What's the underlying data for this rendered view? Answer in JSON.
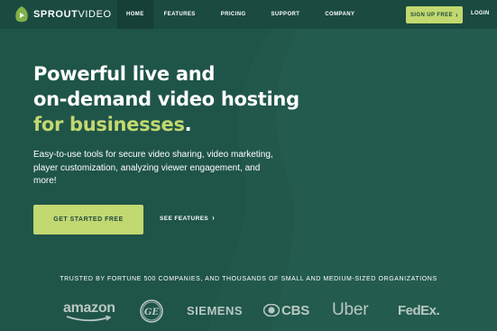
{
  "colors": {
    "background": "#1f5449",
    "header_background": "#1a4a40",
    "accent": "#c2d870",
    "accent_text": "#1f4a3d",
    "logo_muted": "#b9c8c3"
  },
  "brand": {
    "logo_icon": "play-icon",
    "name_bold": "SPROUT",
    "name_light": "VIDEO"
  },
  "nav": {
    "items": [
      {
        "label": "HOME",
        "active": true
      },
      {
        "label": "FEATURES",
        "active": false
      },
      {
        "label": "PRICING",
        "active": false
      },
      {
        "label": "SUPPORT",
        "active": false
      },
      {
        "label": "COMPANY",
        "active": false
      }
    ],
    "signup_label": "SIGN UP FREE",
    "signup_icon": "chevron-right-icon",
    "login_label": "LOGIN"
  },
  "hero": {
    "title_line1": "Powerful live and",
    "title_line2": "on-demand video hosting",
    "title_accent": "for businesses",
    "title_period": ".",
    "subtitle": "Easy-to-use tools for secure video sharing, video marketing, player customization, analyzing viewer engagement, and more!",
    "cta_label": "GET STARTED FREE",
    "secondary_label": "SEE FEATURES",
    "secondary_icon": "chevron-right-icon"
  },
  "trusted": {
    "heading": "TRUSTED BY FORTUNE 500 COMPANIES, AND THOUSANDS OF SMALL AND MEDIUM-SIZED ORGANIZATIONS",
    "logos": {
      "amazon": "amazon",
      "ge": "GE",
      "siemens": "SIEMENS",
      "cbs": "CBS",
      "uber": "Uber",
      "fedex": "FedEx."
    }
  }
}
